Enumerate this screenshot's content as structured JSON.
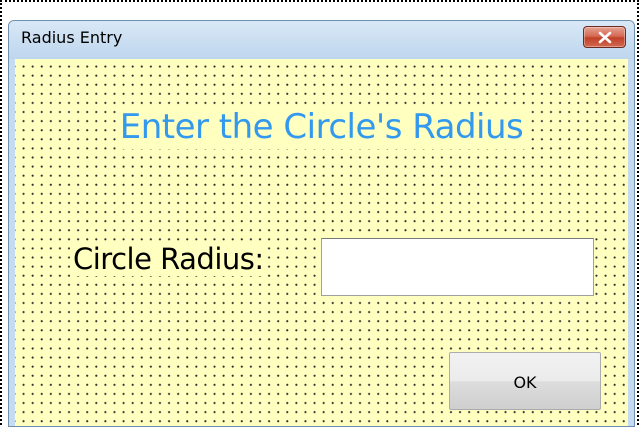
{
  "window": {
    "title": "Radius Entry",
    "close_icon": "close-x-icon"
  },
  "form": {
    "heading": "Enter the Circle's Radius",
    "radius_label": "Circle Radius:",
    "radius_value": "",
    "ok_label": "OK"
  },
  "colors": {
    "form_background": "#ffffc0",
    "heading_text": "#3399ee",
    "close_button": "#c1412a",
    "title_bar": "#c5dcf0"
  }
}
